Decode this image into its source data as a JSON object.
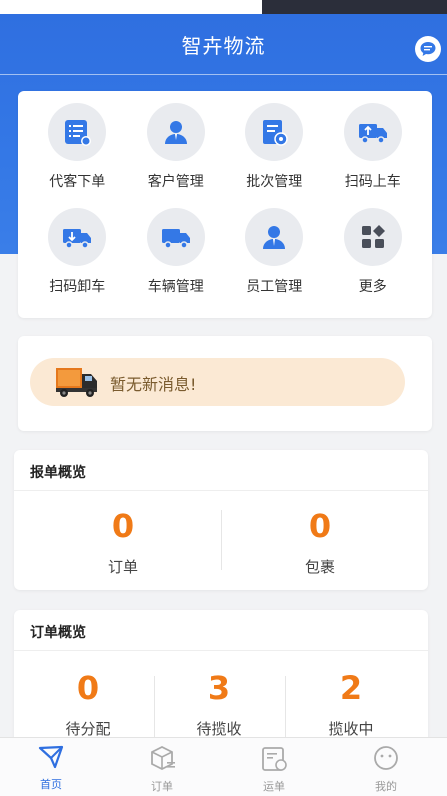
{
  "app": {
    "title": "智卉物流"
  },
  "colors": {
    "primary": "#3478e6",
    "accent": "#f07a17",
    "message_bg": "#fbe9d4"
  },
  "grid": {
    "items": [
      {
        "label": "代客下单",
        "icon": "order-list-icon"
      },
      {
        "label": "客户管理",
        "icon": "user-icon"
      },
      {
        "label": "批次管理",
        "icon": "batch-settings-icon"
      },
      {
        "label": "扫码上车",
        "icon": "truck-load-icon"
      },
      {
        "label": "扫码卸车",
        "icon": "truck-unload-icon"
      },
      {
        "label": "车辆管理",
        "icon": "truck-icon"
      },
      {
        "label": "员工管理",
        "icon": "staff-icon"
      },
      {
        "label": "更多",
        "icon": "more-apps-icon"
      }
    ]
  },
  "message": {
    "text": "暂无新消息!"
  },
  "report_overview": {
    "title": "报单概览",
    "stats": [
      {
        "value": "0",
        "label": "订单"
      },
      {
        "value": "0",
        "label": "包裹"
      }
    ]
  },
  "order_overview": {
    "title": "订单概览",
    "stats": [
      {
        "value": "0",
        "label": "待分配"
      },
      {
        "value": "3",
        "label": "待揽收"
      },
      {
        "value": "2",
        "label": "揽收中"
      }
    ]
  },
  "tabbar": {
    "tabs": [
      {
        "label": "首页",
        "icon": "home-send-icon",
        "active": true
      },
      {
        "label": "订单",
        "icon": "order-box-icon",
        "active": false
      },
      {
        "label": "运单",
        "icon": "waybill-icon",
        "active": false
      },
      {
        "label": "我的",
        "icon": "profile-face-icon",
        "active": false
      }
    ]
  }
}
